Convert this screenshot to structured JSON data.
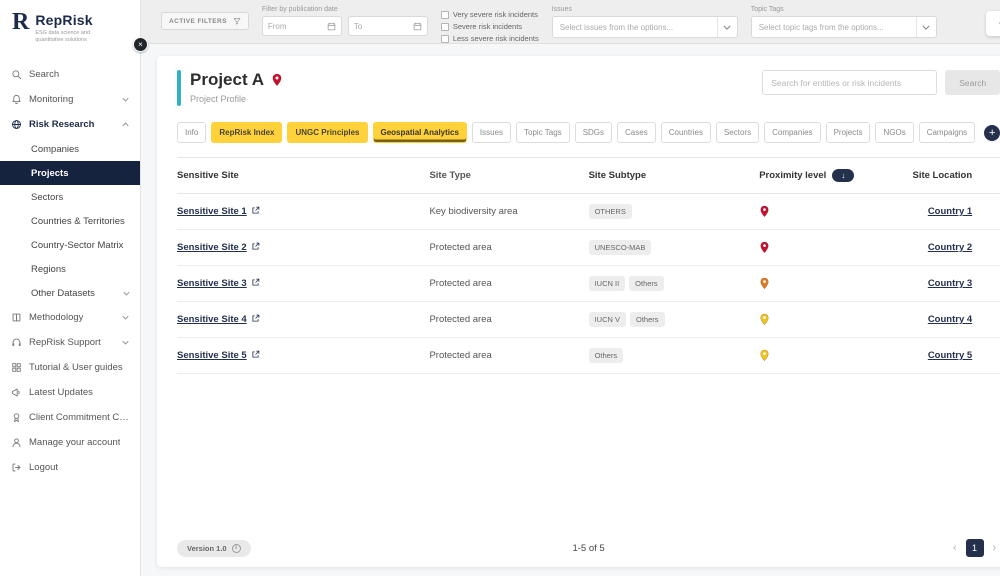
{
  "brand": {
    "logo_letter": "R",
    "name": "RepRisk",
    "tagline": "ESG data science and quantitative solutions"
  },
  "sidebar_toggle": "×",
  "sidebar": {
    "items": [
      {
        "label": "Search",
        "icon": "search",
        "type": "top"
      },
      {
        "label": "Monitoring",
        "icon": "bell",
        "type": "top",
        "chevron": "down"
      },
      {
        "label": "Risk Research",
        "icon": "globe",
        "type": "top",
        "chevron": "up",
        "section_open": true
      },
      {
        "label": "Companies",
        "type": "sub"
      },
      {
        "label": "Projects",
        "type": "sub",
        "active": true
      },
      {
        "label": "Sectors",
        "type": "sub"
      },
      {
        "label": "Countries & Territories",
        "type": "sub"
      },
      {
        "label": "Country-Sector Matrix",
        "type": "sub"
      },
      {
        "label": "Regions",
        "type": "sub"
      },
      {
        "label": "Other Datasets",
        "type": "sub",
        "chevron": "down"
      },
      {
        "label": "Methodology",
        "icon": "book",
        "type": "top",
        "chevron": "down"
      },
      {
        "label": "RepRisk Support",
        "icon": "headset",
        "type": "top",
        "chevron": "down"
      },
      {
        "label": "Tutorial & User guides",
        "icon": "grid",
        "type": "top"
      },
      {
        "label": "Latest Updates",
        "icon": "megaphone",
        "type": "top"
      },
      {
        "label": "Client Commitment Charter",
        "icon": "badge",
        "type": "top"
      },
      {
        "label": "Manage your account",
        "icon": "user",
        "type": "top"
      },
      {
        "label": "Logout",
        "icon": "logout",
        "type": "top"
      }
    ]
  },
  "filter_bar": {
    "active_filters": "ACTIVE FILTERS",
    "publication_date_label": "Filter by publication date",
    "from_placeholder": "From",
    "to_placeholder": "To",
    "severity_options": [
      "Very severe risk incidents",
      "Severe risk incidents",
      "Less severe risk incidents"
    ],
    "issues_label": "Issues",
    "issues_placeholder": "Select issues from the options...",
    "topic_tags_label": "Topic Tags",
    "topic_tags_placeholder": "Select topic tags from the options..."
  },
  "header": {
    "title": "Project A",
    "subtitle": "Project Profile",
    "search_placeholder": "Search for entities or risk incidents",
    "search_button": "Search"
  },
  "tabs": [
    {
      "label": "Info",
      "variant": "plain"
    },
    {
      "label": "RepRisk Index",
      "variant": "yellow"
    },
    {
      "label": "UNGC Principles",
      "variant": "yellow"
    },
    {
      "label": "Geospatial Analytics",
      "variant": "yellow-active"
    },
    {
      "label": "Issues",
      "variant": "plain"
    },
    {
      "label": "Topic Tags",
      "variant": "plain"
    },
    {
      "label": "SDGs",
      "variant": "plain"
    },
    {
      "label": "Cases",
      "variant": "plain"
    },
    {
      "label": "Countries",
      "variant": "plain"
    },
    {
      "label": "Sectors",
      "variant": "plain"
    },
    {
      "label": "Companies",
      "variant": "plain"
    },
    {
      "label": "Projects",
      "variant": "plain"
    },
    {
      "label": "NGOs",
      "variant": "plain"
    },
    {
      "label": "Campaigns",
      "variant": "plain"
    }
  ],
  "add_tab_icon": "+",
  "table": {
    "columns": {
      "site": "Sensitive Site",
      "type": "Site Type",
      "subtype": "Site Subtype",
      "proximity": "Proximity level",
      "location": "Site Location"
    },
    "sort_icon": "↓",
    "rows": [
      {
        "site": "Sensitive Site 1",
        "type": "Key biodiversity area",
        "subtypes": [
          "OTHERS"
        ],
        "proximity": "red",
        "location": "Country 1"
      },
      {
        "site": "Sensitive Site 2",
        "type": "Protected area",
        "subtypes": [
          "UNESCO-MAB"
        ],
        "proximity": "red",
        "location": "Country 2"
      },
      {
        "site": "Sensitive Site 3",
        "type": "Protected area",
        "subtypes": [
          "IUCN II",
          "Others"
        ],
        "proximity": "orange",
        "location": "Country 3"
      },
      {
        "site": "Sensitive Site 4",
        "type": "Protected area",
        "subtypes": [
          "IUCN V",
          "Others"
        ],
        "proximity": "yellow",
        "location": "Country 4"
      },
      {
        "site": "Sensitive Site 5",
        "type": "Protected area",
        "subtypes": [
          "Others"
        ],
        "proximity": "yellow",
        "location": "Country 5"
      }
    ]
  },
  "footer": {
    "version": "Version 1.0",
    "info_icon": "i",
    "range_text": "1-5 of 5",
    "prev": "‹",
    "page": "1",
    "next": "›"
  },
  "colors": {
    "navy": "#25304d",
    "tab_yellow": "#ffd23c",
    "tab_active_underline": "#7a5f17",
    "accent_teal": "#2bb3c0",
    "pin_red": "#c8102e",
    "pin_orange": "#e07c1f",
    "pin_yellow": "#f0c419"
  }
}
